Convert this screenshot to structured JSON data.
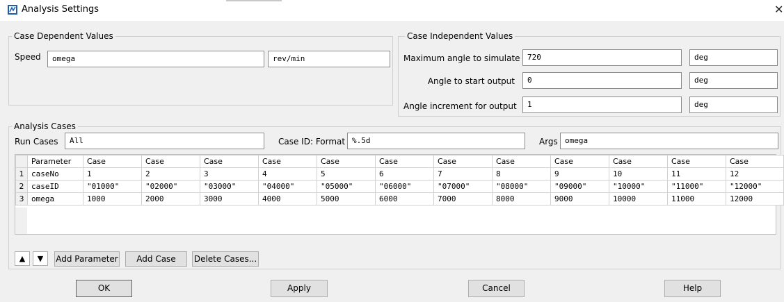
{
  "window": {
    "title": "Analysis Settings",
    "close_glyph": "✕"
  },
  "case_dependent": {
    "group_label": "Case Dependent Values",
    "speed_label": "Speed",
    "speed_value": "omega",
    "speed_unit": "rev/min"
  },
  "case_independent": {
    "group_label": "Case Independent Values",
    "rows": [
      {
        "label": "Maximum angle to simulate",
        "value": "720",
        "unit": "deg"
      },
      {
        "label": "Angle to start output",
        "value": "0",
        "unit": "deg"
      },
      {
        "label": "Angle increment for output",
        "value": "1",
        "unit": "deg"
      }
    ]
  },
  "analysis_cases": {
    "group_label": "Analysis Cases",
    "run_cases_label": "Run Cases",
    "run_cases_value": "All",
    "case_id_format_label": "Case ID: Format",
    "case_id_format_value": "%.5d",
    "args_label": "Args",
    "args_value": "omega"
  },
  "table": {
    "headers": [
      "Parameter",
      "Case",
      "Case",
      "Case",
      "Case",
      "Case",
      "Case",
      "Case",
      "Case",
      "Case",
      "Case",
      "Case",
      "Case"
    ],
    "rows": [
      {
        "num": "1",
        "cells": [
          "caseNo",
          "1",
          "2",
          "3",
          "4",
          "5",
          "6",
          "7",
          "8",
          "9",
          "10",
          "11",
          "12"
        ]
      },
      {
        "num": "2",
        "cells": [
          "caseID",
          "\"01000\"",
          "\"02000\"",
          "\"03000\"",
          "\"04000\"",
          "\"05000\"",
          "\"06000\"",
          "\"07000\"",
          "\"08000\"",
          "\"09000\"",
          "\"10000\"",
          "\"11000\"",
          "\"12000\""
        ]
      },
      {
        "num": "3",
        "cells": [
          "omega",
          "1000",
          "2000",
          "3000",
          "4000",
          "5000",
          "6000",
          "7000",
          "8000",
          "9000",
          "10000",
          "11000",
          "12000"
        ]
      }
    ]
  },
  "table_buttons": {
    "up_glyph": "▲",
    "down_glyph": "▼",
    "add_parameter": "Add Parameter",
    "add_case": "Add Case",
    "delete_cases": "Delete Cases..."
  },
  "dialog_buttons": {
    "ok": "OK",
    "apply": "Apply",
    "cancel": "Cancel",
    "help": "Help"
  },
  "colors": {
    "accent_border": "#0078d7",
    "window_bg": "#f0f0f0"
  },
  "icons": {
    "app": "analysis-app-icon",
    "close": "close-icon",
    "up": "move-up-icon",
    "down": "move-down-icon"
  }
}
